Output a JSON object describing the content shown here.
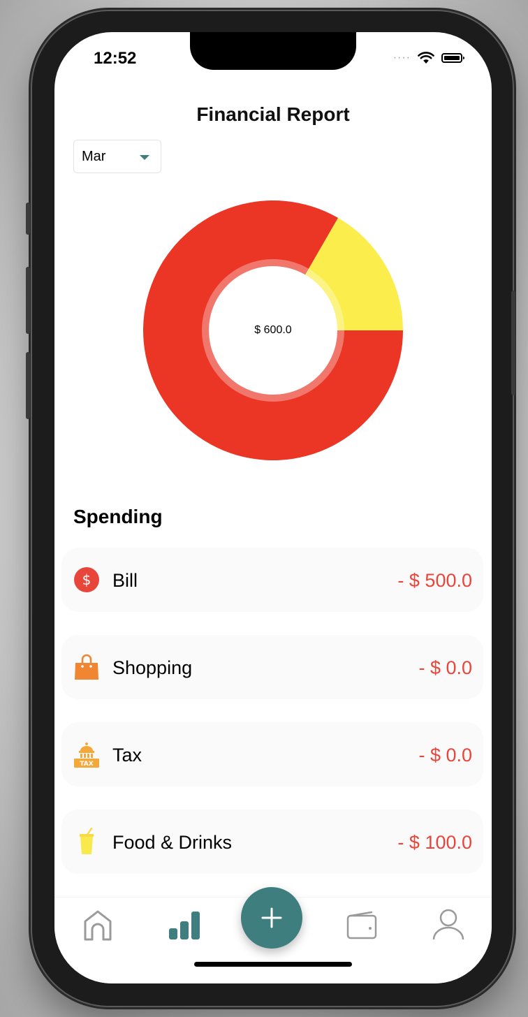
{
  "status_bar": {
    "time": "12:52"
  },
  "header": {
    "title": "Financial Report"
  },
  "filter": {
    "month": "Mar"
  },
  "summary": {
    "center_label": "$ 600.0",
    "slices": [
      {
        "name": "Bill",
        "value": 500,
        "color": "#eb3525"
      },
      {
        "name": "Food & Drinks",
        "value": 100,
        "color": "#fbee4c"
      }
    ]
  },
  "spending": {
    "title": "Spending",
    "items": [
      {
        "label": "Bill",
        "amount": "- $ 500.0",
        "icon": "dollar-coin-icon"
      },
      {
        "label": "Shopping",
        "amount": "- $ 0.0",
        "icon": "shopping-bag-icon"
      },
      {
        "label": "Tax",
        "amount": "- $ 0.0",
        "icon": "tax-building-icon"
      },
      {
        "label": "Food & Drinks",
        "amount": "- $ 100.0",
        "icon": "drink-cup-icon"
      }
    ]
  },
  "colors": {
    "accent": "#3f7e7e",
    "expense": "#e8453b"
  },
  "tabbar": {
    "tabs": [
      {
        "icon": "home-icon",
        "active": false
      },
      {
        "icon": "stats-icon",
        "active": true
      },
      {
        "icon": "wallet-icon",
        "active": false
      },
      {
        "icon": "profile-icon",
        "active": false
      }
    ],
    "fab_icon": "plus-icon"
  }
}
